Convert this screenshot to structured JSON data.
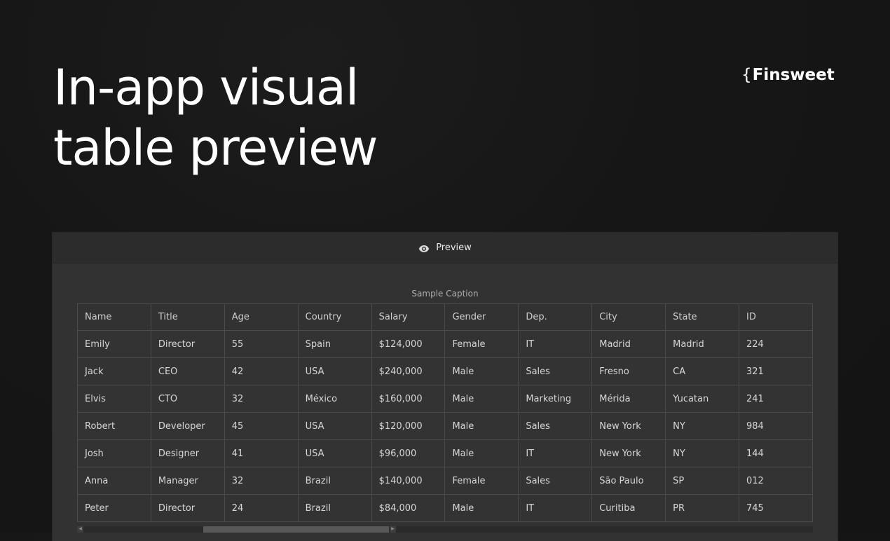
{
  "hero": {
    "title_line1": "In-app visual",
    "title_line2": "table preview"
  },
  "brand": {
    "brace": "{",
    "name": "Finsweet"
  },
  "preview_panel": {
    "header_icon": "eye-icon",
    "header_label": "Preview",
    "caption": "Sample Caption"
  },
  "table": {
    "columns": [
      "Name",
      "Title",
      "Age",
      "Country",
      "Salary",
      "Gender",
      "Dep.",
      "City",
      "State",
      "ID"
    ],
    "rows": [
      [
        "Emily",
        "Director",
        "55",
        "Spain",
        "$124,000",
        "Female",
        "IT",
        "Madrid",
        "Madrid",
        "224"
      ],
      [
        "Jack",
        "CEO",
        "42",
        "USA",
        "$240,000",
        "Male",
        "Sales",
        "Fresno",
        "CA",
        "321"
      ],
      [
        "Elvis",
        "CTO",
        "32",
        "México",
        "$160,000",
        "Male",
        "Marketing",
        "Mérida",
        "Yucatan",
        "241"
      ],
      [
        "Robert",
        "Developer",
        "45",
        "USA",
        "$120,000",
        "Male",
        "Sales",
        "New York",
        "NY",
        "984"
      ],
      [
        "Josh",
        "Designer",
        "41",
        "USA",
        "$96,000",
        "Male",
        "IT",
        "New York",
        "NY",
        "144"
      ],
      [
        "Anna",
        "Manager",
        "32",
        "Brazil",
        "$140,000",
        "Female",
        "Sales",
        "São Paulo",
        "SP",
        "012"
      ],
      [
        "Peter",
        "Director",
        "24",
        "Brazil",
        "$84,000",
        "Male",
        "IT",
        "Curitiba",
        "PR",
        "745"
      ]
    ]
  },
  "colors": {
    "background": "#151515",
    "panel": "#323232",
    "panel_header": "#2c2c2c",
    "grid_line": "#4b4b4b",
    "text": "#d6d6d6"
  }
}
